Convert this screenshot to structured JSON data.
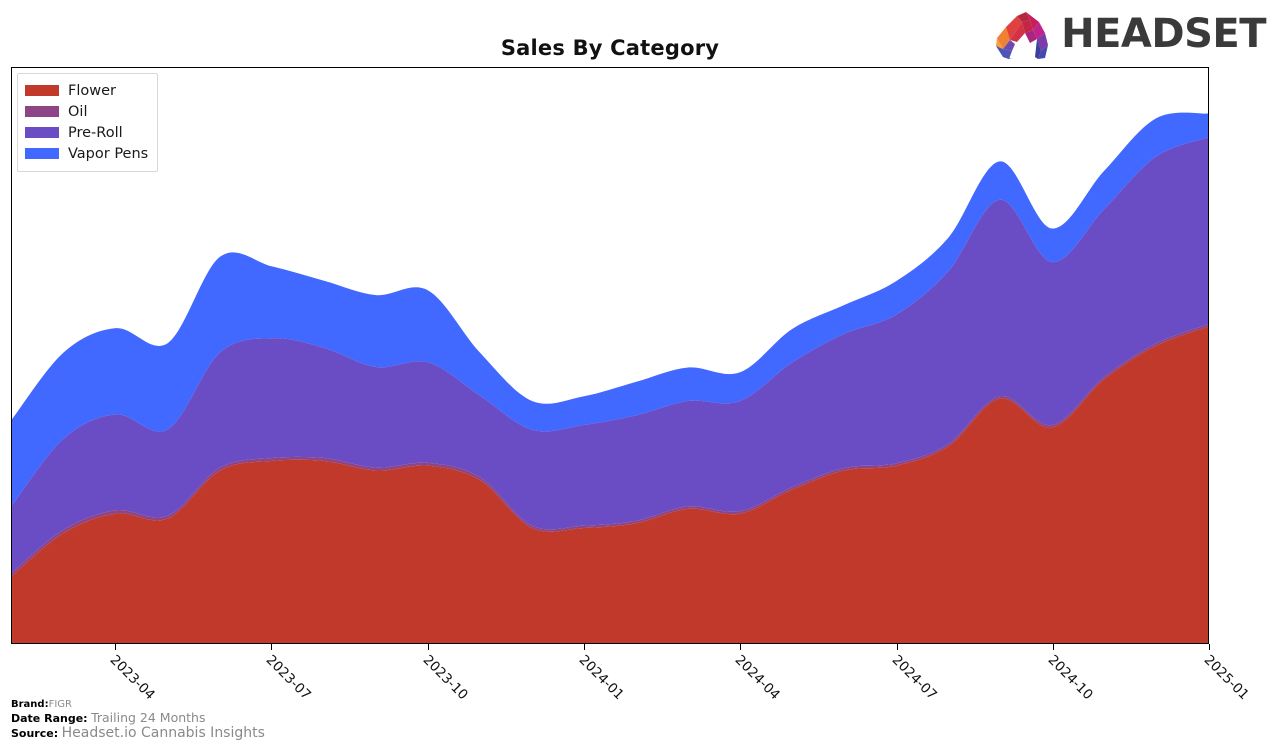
{
  "header": {
    "title": "Sales By Category",
    "logo_word": "HEADSET",
    "logo_icon": "headset-arch-logo"
  },
  "legend": {
    "items": [
      {
        "label": "Flower",
        "color": "#C0392B"
      },
      {
        "label": "Oil",
        "color": "#8E4585"
      },
      {
        "label": "Pre-Roll",
        "color": "#6A4CC4"
      },
      {
        "label": "Vapor Pens",
        "color": "#4169FF"
      }
    ]
  },
  "footer": {
    "brand_key": "Brand:",
    "brand_value": "FIGR",
    "daterange_key": "Date Range:",
    "daterange_value": "Trailing 24 Months",
    "source_key": "Source:",
    "source_value": "Headset.io Cannabis Insights"
  },
  "chart_data": {
    "type": "area",
    "stacked": true,
    "title": "Sales By Category",
    "xlabel": "",
    "ylabel": "",
    "grid": false,
    "legend_position": "top-left",
    "axis_tick_labels": [
      "2023-04",
      "2023-07",
      "2023-10",
      "2024-01",
      "2024-04",
      "2024-07",
      "2024-10",
      "2025-01"
    ],
    "x": [
      "2023-02",
      "2023-03",
      "2023-04",
      "2023-05",
      "2023-06",
      "2023-07",
      "2023-08",
      "2023-09",
      "2023-10",
      "2023-11",
      "2023-12",
      "2024-01",
      "2024-02",
      "2024-03",
      "2024-04",
      "2024-05",
      "2024-06",
      "2024-07",
      "2024-08",
      "2024-09",
      "2024-10",
      "2024-11",
      "2024-12",
      "2025-01"
    ],
    "series": [
      {
        "name": "Flower",
        "color": "#C0392B",
        "values": [
          14,
          23,
          27,
          26,
          36,
          38,
          38,
          36,
          37,
          34,
          24,
          24,
          25,
          28,
          27,
          32,
          36,
          37,
          41,
          51,
          45,
          55,
          62,
          66
        ]
      },
      {
        "name": "Oil",
        "color": "#8E4585",
        "values": [
          0.7,
          0.7,
          0.7,
          0.6,
          0.6,
          0.6,
          0.6,
          0.6,
          0.6,
          0.6,
          0.5,
          0.5,
          0.5,
          0.5,
          0.5,
          0.5,
          0.5,
          0.5,
          0.5,
          0.5,
          0.5,
          0.5,
          0.5,
          0.5
        ]
      },
      {
        "name": "Pre-Roll",
        "color": "#6A4CC4",
        "values": [
          14,
          19,
          20,
          18,
          24,
          25,
          23,
          21,
          21,
          17,
          20,
          21,
          22,
          22,
          23,
          26,
          28,
          31,
          36,
          41,
          34,
          35,
          39,
          39
        ]
      },
      {
        "name": "Vapor Pens",
        "color": "#4169FF",
        "values": [
          18,
          18,
          18,
          18,
          20,
          15,
          14,
          15,
          15,
          9,
          6,
          6,
          7,
          7,
          6,
          7,
          6,
          7,
          7,
          8,
          7,
          8,
          8,
          5
        ]
      }
    ],
    "ylim": [
      0,
      120
    ],
    "units": "index"
  }
}
